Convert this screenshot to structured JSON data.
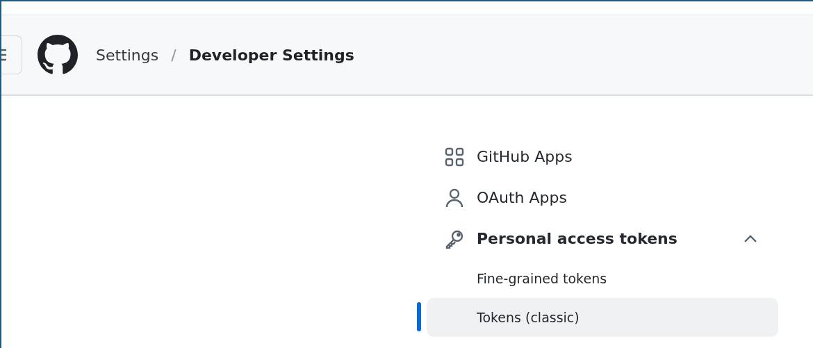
{
  "header": {
    "breadcrumbs": [
      {
        "label": "Settings",
        "current": false
      },
      {
        "label": "/",
        "kind": "separator",
        "current": false
      },
      {
        "label": "Developer Settings",
        "current": true
      }
    ]
  },
  "sidebar": {
    "items": [
      {
        "label": "GitHub Apps",
        "selected": false
      },
      {
        "label": "OAuth Apps",
        "selected": false
      },
      {
        "label": "Personal access tokens",
        "selected": false,
        "expanded": true,
        "children": [
          {
            "label": "Fine-grained tokens",
            "selected": false
          },
          {
            "label": "Tokens (classic)",
            "selected": true
          }
        ]
      }
    ]
  }
}
